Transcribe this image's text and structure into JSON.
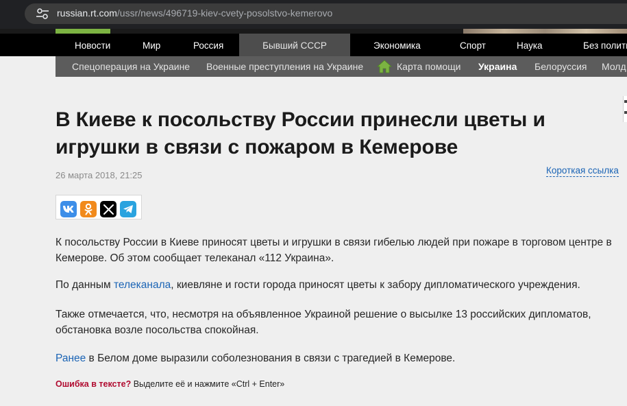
{
  "browser": {
    "url_host": "russian.rt.com",
    "url_path": "/ussr/news/496719-kiev-cvety-posolstvo-kemerovo"
  },
  "nav": {
    "items": [
      {
        "label": "Новости"
      },
      {
        "label": "Мир"
      },
      {
        "label": "Россия"
      },
      {
        "label": "Бывший СССР"
      },
      {
        "label": "Экономика"
      },
      {
        "label": "Спорт"
      },
      {
        "label": "Наука"
      },
      {
        "label": "Без полити"
      }
    ]
  },
  "subnav": {
    "items": [
      {
        "label": "Спецоперация на Украине"
      },
      {
        "label": "Военные преступления на Украине"
      },
      {
        "label": "Карта помощи"
      },
      {
        "label": "Украина"
      },
      {
        "label": "Белоруссия"
      },
      {
        "label": "Молд"
      }
    ]
  },
  "article": {
    "title": "В Киеве к посольству России принесли цветы и игрушки в связи с пожаром в Кемерове",
    "date": "26 марта 2018, 21:25",
    "short_link": "Короткая ссылка",
    "p1": "К посольству России в Киеве приносят цветы и игрушки в связи гибелью людей при пожаре в торговом центре в Кемерове. Об этом сообщает телеканал «112 Украина».",
    "p2_before": "По данным ",
    "p2_link": "телеканала",
    "p2_after": ", киевляне и гости города приносят цветы к забору дипломатического учреждения.",
    "p3": "Также отмечается, что, несмотря на объявленное Украиной решение о высылке 13 российских дипломатов, обстановка возле посольства спокойная.",
    "p4_link": "Ранее",
    "p4_after": " в Белом доме выразили соболезнования в связи с трагедией в Кемерове.",
    "error_bold": "Ошибка в тексте?",
    "error_rest": " Выделите её и нажмите «Ctrl + Enter»"
  },
  "share": {
    "buttons": [
      {
        "icon": "vk-icon",
        "color": "#3d8ee8"
      },
      {
        "icon": "odnoklassniki-icon",
        "color": "#f18a1c"
      },
      {
        "icon": "x-icon",
        "color": "#000000"
      },
      {
        "icon": "telegram-icon",
        "color": "#2aa3df"
      }
    ]
  },
  "colors": {
    "link": "#1b64b5",
    "error_red": "#b00a2f",
    "nav_bg": "#000000",
    "subnav_bg": "#5c5c5c",
    "home_green": "#7cb342"
  }
}
